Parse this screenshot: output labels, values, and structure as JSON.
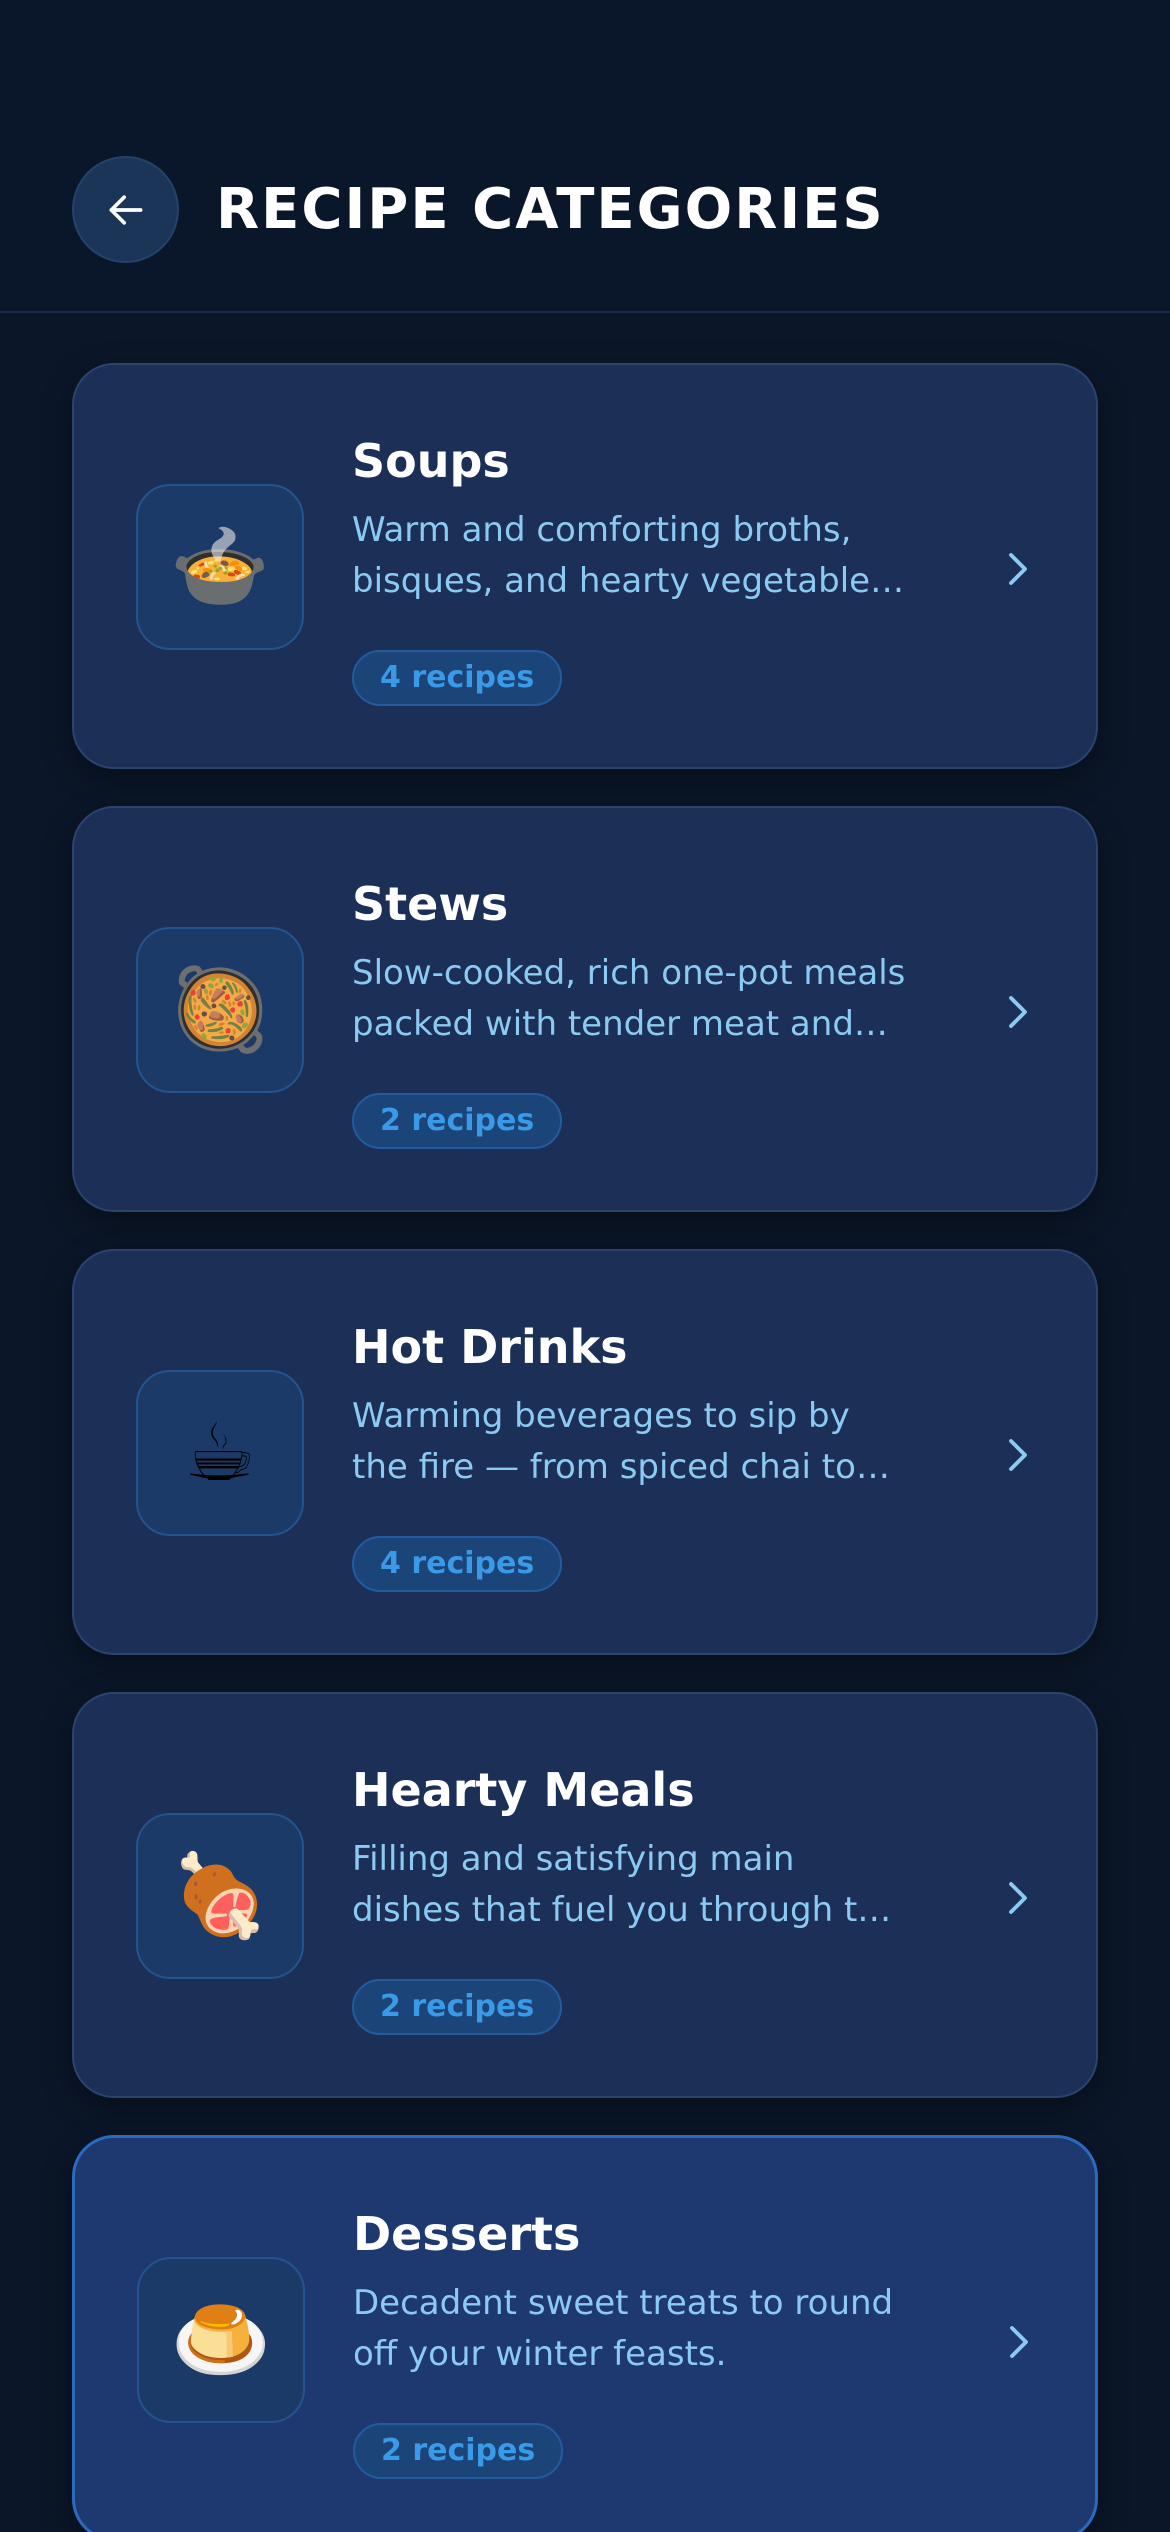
{
  "header": {
    "title": "RECIPE CATEGORIES",
    "back_icon": "arrow-left-icon"
  },
  "categories": [
    {
      "name": "Soups",
      "description": "Warm and comforting broths, bisques, and hearty vegetable…",
      "count_label": "4 recipes",
      "emoji": "🍲",
      "icon": "soup-bowl-icon"
    },
    {
      "name": "Stews",
      "description": "Slow-cooked, rich one-pot meals packed with tender meat and…",
      "count_label": "2 recipes",
      "emoji": "🥘",
      "icon": "stew-pot-icon"
    },
    {
      "name": "Hot Drinks",
      "description": "Warming beverages to sip by the fire — from spiced chai to mulled…",
      "count_label": "4 recipes",
      "emoji": "☕",
      "icon": "coffee-cup-icon"
    },
    {
      "name": "Hearty Meals",
      "description": "Filling and satisfying main dishes that fuel you through the coldest…",
      "count_label": "2 recipes",
      "emoji": "🍖",
      "icon": "meat-on-bone-icon"
    },
    {
      "name": "Desserts",
      "description": "Decadent sweet treats to round off your winter feasts.",
      "count_label": "2 recipes",
      "emoji": "🍮",
      "icon": "custard-icon"
    }
  ],
  "colors": {
    "background": "#0b1628",
    "card": "#1b2f57",
    "card_highlight_border": "#2b6bbf",
    "description": "#8ccaf2",
    "badge_text": "#3a9ae8"
  }
}
